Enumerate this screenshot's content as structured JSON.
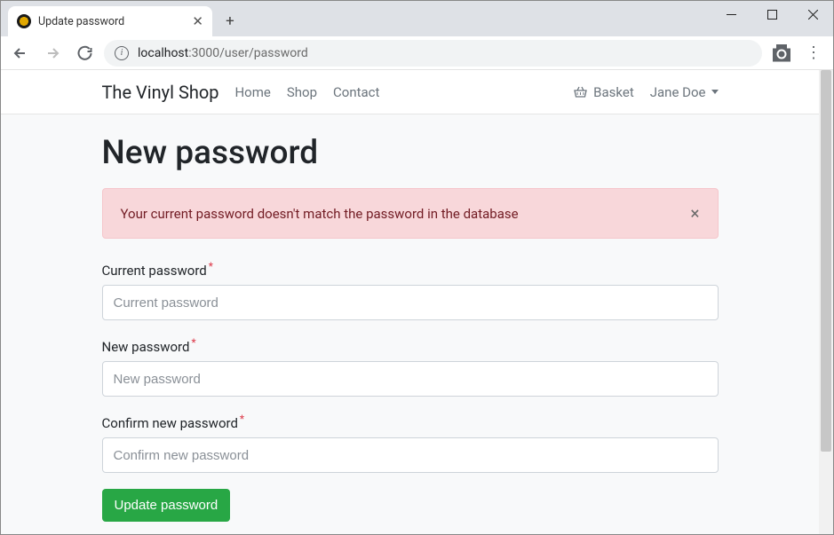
{
  "browser": {
    "tab_title": "Update password",
    "url_host": "localhost",
    "url_port_path": ":3000/user/password"
  },
  "navbar": {
    "brand": "The Vinyl Shop",
    "links": [
      "Home",
      "Shop",
      "Contact"
    ],
    "basket_label": "Basket",
    "user_name": "Jane Doe"
  },
  "page": {
    "heading": "New password",
    "alert": "Your current password doesn't match the password in the database",
    "fields": {
      "current": {
        "label": "Current password",
        "placeholder": "Current password"
      },
      "new": {
        "label": "New password",
        "placeholder": "New password"
      },
      "confirm": {
        "label": "Confirm new password",
        "placeholder": "Confirm new password"
      }
    },
    "submit_label": "Update password"
  }
}
